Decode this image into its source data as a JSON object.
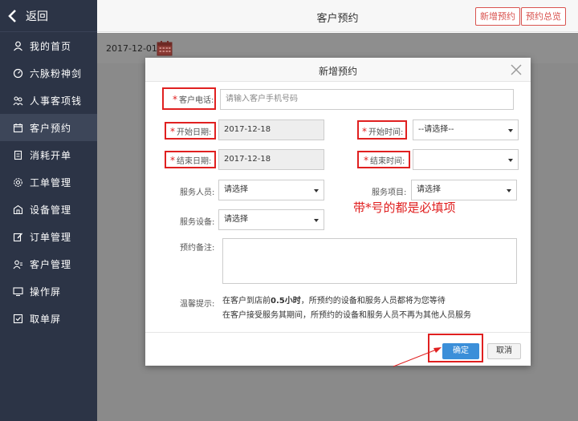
{
  "sidebar": {
    "back_label": "返回",
    "items": [
      {
        "label": "我的首页",
        "icon": "user-icon"
      },
      {
        "label": "六脉粉神剑",
        "icon": "gauge-icon"
      },
      {
        "label": "人事客项钱",
        "icon": "people-icon"
      },
      {
        "label": "客户预约",
        "icon": "calendar-icon",
        "active": true
      },
      {
        "label": "消耗开单",
        "icon": "document-icon"
      },
      {
        "label": "工单管理",
        "icon": "gear-icon"
      },
      {
        "label": "设备管理",
        "icon": "building-icon"
      },
      {
        "label": "订单管理",
        "icon": "edit-icon"
      },
      {
        "label": "客户管理",
        "icon": "customer-icon"
      },
      {
        "label": "操作屏",
        "icon": "monitor-icon"
      },
      {
        "label": "取单屏",
        "icon": "checkbox-icon"
      }
    ]
  },
  "header": {
    "title": "客户预约",
    "new_button": "新增预约",
    "overview_button": "预约总览"
  },
  "content": {
    "date": "2017-12-01"
  },
  "modal": {
    "title": "新增预约",
    "phone": {
      "label": "客户电话:",
      "placeholder": "请输入客户手机号码"
    },
    "start_date": {
      "label": "开始日期:",
      "value": "2017-12-18"
    },
    "end_date": {
      "label": "结束日期:",
      "value": "2017-12-18"
    },
    "start_time": {
      "label": "开始时间:",
      "value": "--请选择--"
    },
    "end_time": {
      "label": "结束时间:",
      "value": ""
    },
    "staff": {
      "label": "服务人员:",
      "value": "请选择"
    },
    "project": {
      "label": "服务项目:",
      "value": "请选择"
    },
    "device": {
      "label": "服务设备:",
      "value": "请选择"
    },
    "remark": {
      "label": "预约备注:"
    },
    "tip": {
      "label": "温馨提示:",
      "line1_a": "在客户到店前",
      "line1_bold": "0.5小时",
      "line1_b": "，所预约的设备和服务人员都将为您等待",
      "line2": "在客户接受服务其期间，所预约的设备和服务人员不再为其他人员服务"
    },
    "required_hint": "带*号的都是必填项",
    "star": "*",
    "ok_button": "确定",
    "cancel_button": "取消"
  },
  "colors": {
    "sidebar_bg": "#2c3446",
    "accent_red": "#e02020",
    "primary_blue": "#3b8fd9"
  }
}
